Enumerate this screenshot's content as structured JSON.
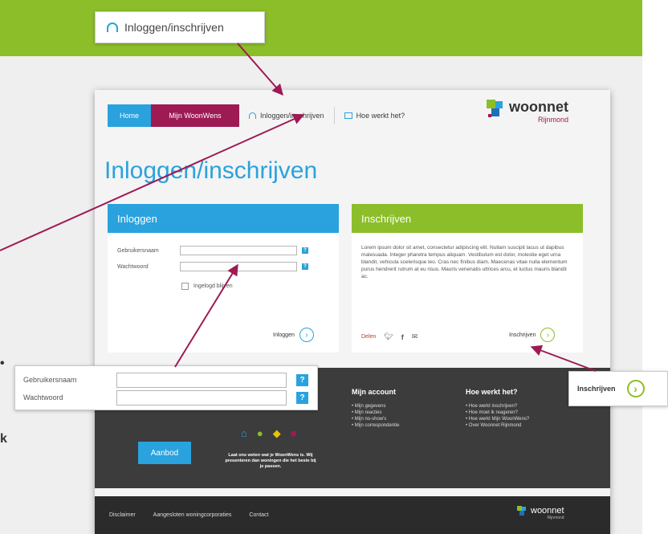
{
  "callouts": {
    "login_label": "Inloggen/inschrijven",
    "field_username": "Gebruikersnaam",
    "field_password": "Wachtwoord",
    "help_symbol": "?",
    "inschrijven_label": "Inschrijven"
  },
  "left_edge": {
    "dot": "•",
    "letter_k": "k"
  },
  "mock": {
    "nav": {
      "home": "Home",
      "mijn": "Mijn WoonWens",
      "login": "Inloggen/inschrijven",
      "how": "Hoe werkt het?"
    },
    "logo": {
      "name": "woonnet",
      "sub": "Rijnmond"
    },
    "page_title": "Inloggen/inschrijven",
    "login_panel": {
      "title": "Inloggen",
      "username_label": "Gebruikersnaam",
      "password_label": "Wachtwoord",
      "remember": "Ingelogd blijven",
      "submit": "Inloggen"
    },
    "signup_panel": {
      "title": "Inschrijven",
      "text": "Lorem ipsum dolor sit amet, consectetur adipiscing elit. Nullam suscipit lacus ut dapibus malesuada. Integer pharetra tempus aliquam. Vestibulum est dolor, molestie eget urna blandit, vehicula scelerisque leo. Cras nec finibus diam. Maecenas vitae nulla elementum purus hendrerit rutrum at eu risus. Mauris venenatis ultrices arcu, et luctus mauris blandit ac.",
      "share": "Delen",
      "submit": "Inschrijven"
    },
    "footer": {
      "aanbod": "Aanbod",
      "note": "Laat ons weten wat je WoonWens is. Wij presenteren dan woningen die het beste bij je passen.",
      "col1_title": "Mijn account",
      "col1_items": [
        "Mijn gegevens",
        "Mijn reacties",
        "Mijn no-show's",
        "Mijn correspondentie"
      ],
      "col2_title": "Hoe werkt het?",
      "col2_items": [
        "Hoe werkt inschrijven?",
        "Hoe moet ik reageren?",
        "Hoe werkt Mijn WoonWens?",
        "Over Woonnet Rijnmond"
      ]
    },
    "bottom": {
      "links": [
        "Disclaimer",
        "Aangesloten woningcorporaties",
        "Contact"
      ],
      "logo": "woonnet",
      "logo_sub": "Rijnmond"
    }
  },
  "colors": {
    "green": "#8cbe2a",
    "blue": "#2aa2dd",
    "magenta": "#9d1a53",
    "arrow": "#9d1a53"
  }
}
